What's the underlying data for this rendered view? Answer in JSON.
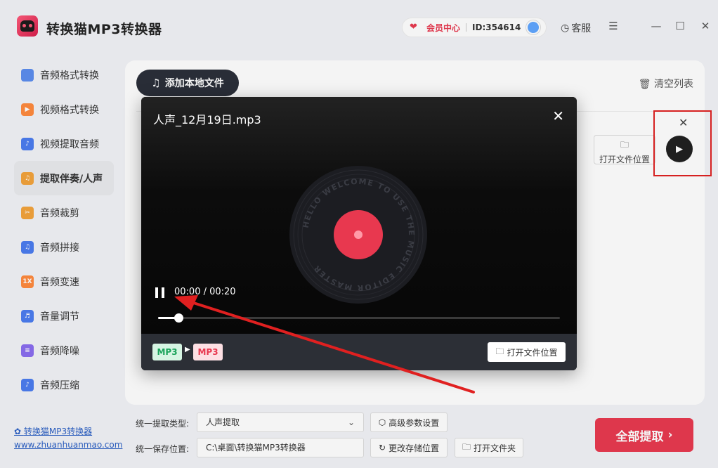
{
  "app": {
    "title": "转换猫MP3转换器",
    "member_label": "会员中心",
    "user_id": "ID:354614",
    "service_label": "客服"
  },
  "sidebar": {
    "items": [
      {
        "label": "音频格式转换",
        "icon": "audio-format-icon",
        "color": "#5b8def"
      },
      {
        "label": "视频格式转换",
        "icon": "video-format-icon",
        "color": "#ff8a3d"
      },
      {
        "label": "视频提取音频",
        "icon": "video-extract-icon",
        "color": "#4a7cf0"
      },
      {
        "label": "提取伴奏/人声",
        "icon": "vocal-extract-icon",
        "color": "#f3a33a"
      },
      {
        "label": "音频裁剪",
        "icon": "audio-cut-icon",
        "color": "#f3a33a"
      },
      {
        "label": "音频拼接",
        "icon": "audio-join-icon",
        "color": "#4a7cf0"
      },
      {
        "label": "音频变速",
        "icon": "speed-icon",
        "color": "#ff8a3d",
        "badge": "1X"
      },
      {
        "label": "音量调节",
        "icon": "volume-icon",
        "color": "#4a7cf0"
      },
      {
        "label": "音频降噪",
        "icon": "denoise-icon",
        "color": "#8a6cf0"
      },
      {
        "label": "音频压缩",
        "icon": "compress-icon",
        "color": "#4a7cf0"
      }
    ],
    "active_index": 3,
    "footer_link": "转换猫MP3转换器",
    "footer_url": "www.zhuanhuanmao.com"
  },
  "main": {
    "add_file_label": "添加本地文件",
    "clear_list_label": "清空列表",
    "row_open_location": "打开文件位置"
  },
  "settings": {
    "extract_type_label": "统一提取类型:",
    "extract_type_value": "人声提取",
    "advanced_label": "高级参数设置",
    "save_location_label": "统一保存位置:",
    "save_location_value": "C:\\桌面\\转换猫MP3转换器",
    "change_location_label": "更改存储位置",
    "open_folder_label": "打开文件夹",
    "extract_all_label": "全部提取"
  },
  "player": {
    "file_name": "人声_12月19日.mp3",
    "time": "00:00 / 00:20",
    "progress": 0.05,
    "input_format": "MP3",
    "output_format": "MP3",
    "open_location_label": "打开文件位置",
    "vinyl_text": "HELLO WELCOME TO USE THE MUSIC EDITOR MASTER"
  },
  "colors": {
    "accent": "#e8384f",
    "dark_button": "#2a2e38",
    "link": "#2b5fc4"
  }
}
